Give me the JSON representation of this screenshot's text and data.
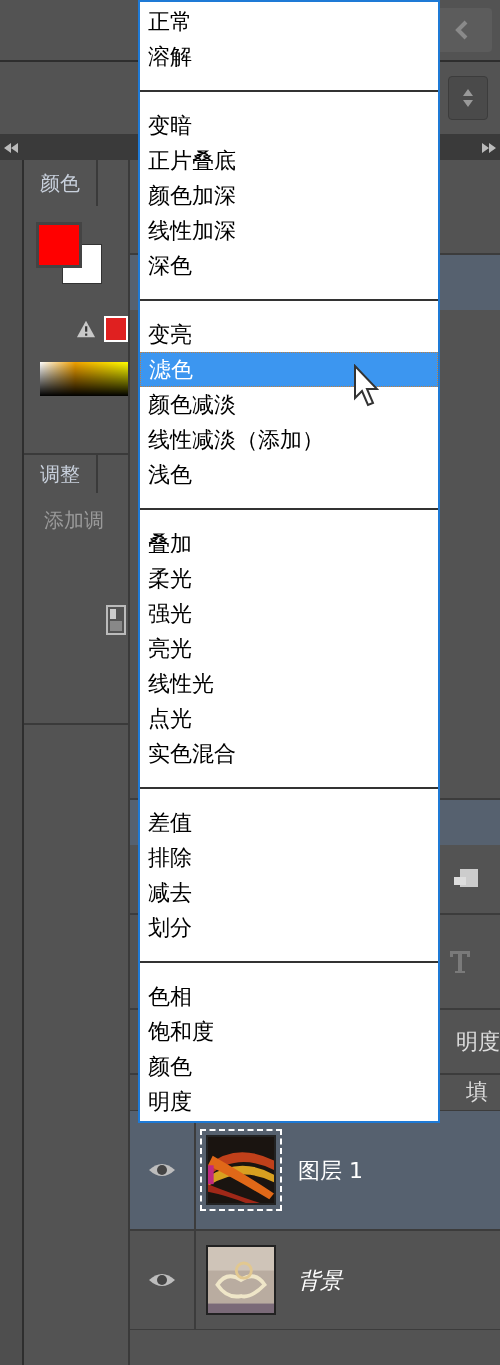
{
  "blend_menu": {
    "groups": [
      [
        {
          "label": "正常",
          "selected": false
        },
        {
          "label": "溶解",
          "selected": false
        }
      ],
      [
        {
          "label": "变暗",
          "selected": false
        },
        {
          "label": "正片叠底",
          "selected": false
        },
        {
          "label": "颜色加深",
          "selected": false
        },
        {
          "label": "线性加深",
          "selected": false
        },
        {
          "label": "深色",
          "selected": false
        }
      ],
      [
        {
          "label": "变亮",
          "selected": false
        },
        {
          "label": "滤色",
          "selected": true
        },
        {
          "label": "颜色减淡",
          "selected": false
        },
        {
          "label": "线性减淡（添加）",
          "selected": false
        },
        {
          "label": "浅色",
          "selected": false
        }
      ],
      [
        {
          "label": "叠加",
          "selected": false
        },
        {
          "label": "柔光",
          "selected": false
        },
        {
          "label": "强光",
          "selected": false
        },
        {
          "label": "亮光",
          "selected": false
        },
        {
          "label": "线性光",
          "selected": false
        },
        {
          "label": "点光",
          "selected": false
        },
        {
          "label": "实色混合",
          "selected": false
        }
      ],
      [
        {
          "label": "差值",
          "selected": false
        },
        {
          "label": "排除",
          "selected": false
        },
        {
          "label": "减去",
          "selected": false
        },
        {
          "label": "划分",
          "selected": false
        }
      ],
      [
        {
          "label": "色相",
          "selected": false
        },
        {
          "label": "饱和度",
          "selected": false
        },
        {
          "label": "颜色",
          "selected": false
        },
        {
          "label": "明度",
          "selected": false
        }
      ]
    ]
  },
  "color_panel": {
    "tab": "颜色"
  },
  "adjustments_panel": {
    "tab": "调整",
    "hint": "添加调"
  },
  "layers_panel": {
    "opacity_label": "明度",
    "fill_label": "填",
    "layers": [
      {
        "name": "图层 1",
        "selected": true
      },
      {
        "name": "背景",
        "selected": false
      }
    ]
  }
}
